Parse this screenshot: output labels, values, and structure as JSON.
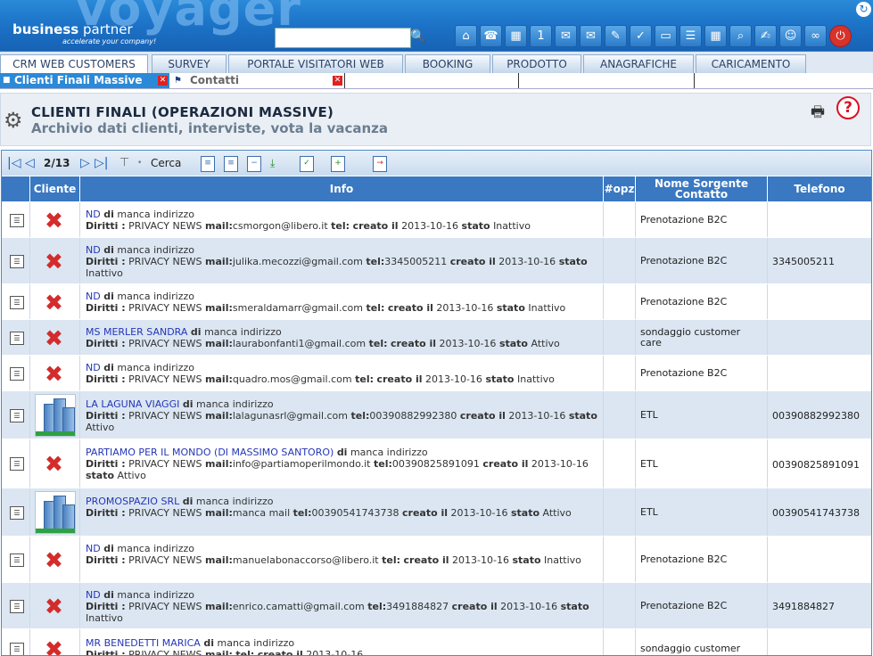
{
  "header": {
    "brand_bg": "voyager",
    "brand_name_bold": "business",
    "brand_name": " partner",
    "brand_tagline": "accelerate your company!",
    "search_placeholder": "",
    "icons": [
      "home-icon",
      "phone-icon",
      "calendar-add-icon",
      "calendar-icon",
      "mail-delete-icon",
      "mail-icon",
      "pen-icon",
      "checklist-icon",
      "card-icon",
      "document-icon",
      "calculator-icon",
      "magnifier-icon",
      "notepad-icon",
      "users-icon",
      "link-icon",
      "power-icon"
    ]
  },
  "menu": [
    "CRM WEB CUSTOMERS",
    "SURVEY",
    "PORTALE VISITATORI WEB",
    "BOOKING",
    "PRODOTTO",
    "ANAGRAFICHE",
    "CARICAMENTO"
  ],
  "tabs": [
    {
      "label": "Clienti Finali Massive",
      "active": true
    },
    {
      "label": "Contatti",
      "active": false
    }
  ],
  "page": {
    "title": "CLIENTI FINALI (OPERAZIONI MASSIVE)",
    "subtitle": "Archivio dati clienti, interviste, vota la vacanza"
  },
  "toolbar": {
    "page_indicator": "2/13",
    "search_label": "Cerca"
  },
  "columns": {
    "cliente": "Cliente",
    "info": "Info",
    "opz": "#opz",
    "sorgente": "Nome Sorgente Contatto",
    "telefono": "Telefono"
  },
  "labels": {
    "di": "di",
    "diritti": "Diritti :",
    "mail": "mail:",
    "tel": "tel:",
    "creato": "creato il",
    "stato": "stato"
  },
  "rows": [
    {
      "name": "ND",
      "address": "manca indirizzo",
      "rights": "PRIVACY NEWS",
      "mail": "csmorgon@libero.it",
      "tel": "",
      "created": "2013-10-16",
      "state": "Inattivo",
      "source": "Prenotazione B2C",
      "phone": "",
      "icon": "x"
    },
    {
      "name": "ND",
      "address": "manca indirizzo",
      "rights": "PRIVACY NEWS",
      "mail": "julika.mecozzi@gmail.com",
      "tel": "3345005211",
      "created": "2013-10-16",
      "state": "Inattivo",
      "source": "Prenotazione B2C",
      "phone": "3345005211",
      "icon": "x"
    },
    {
      "name": "ND",
      "address": "manca indirizzo",
      "rights": "PRIVACY NEWS",
      "mail": "smeraldamarr@gmail.com",
      "tel": "",
      "created": "2013-10-16",
      "state": "Inattivo",
      "source": "Prenotazione B2C",
      "phone": "",
      "icon": "x"
    },
    {
      "name": "MS MERLER SANDRA",
      "address": "manca indirizzo",
      "rights": "PRIVACY NEWS",
      "mail": "laurabonfanti1@gmail.com",
      "tel": "",
      "created": "2013-10-16",
      "state": "Attivo",
      "source": "sondaggio customer care",
      "phone": "",
      "icon": "x"
    },
    {
      "name": "ND",
      "address": "manca indirizzo",
      "rights": "PRIVACY NEWS",
      "mail": "quadro.mos@gmail.com",
      "tel": "",
      "created": "2013-10-16",
      "state": "Inattivo",
      "source": "Prenotazione B2C",
      "phone": "",
      "icon": "x"
    },
    {
      "name": "LA LAGUNA VIAGGI",
      "address": "manca indirizzo",
      "rights": "PRIVACY NEWS",
      "mail": "lalagunasrl@gmail.com",
      "tel": "00390882992380",
      "created": "2013-10-16",
      "state": "Attivo",
      "source": "ETL",
      "phone": "00390882992380",
      "icon": "building"
    },
    {
      "name": "PARTIAMO PER IL MONDO (DI MASSIMO SANTORO)",
      "address": "manca indirizzo",
      "rights": "PRIVACY NEWS",
      "mail": "info@partiamoperilmondo.it",
      "tel": "00390825891091",
      "created": "2013-10-16",
      "state": "Attivo",
      "source": "ETL",
      "phone": "00390825891091",
      "icon": "x"
    },
    {
      "name": "PROMOSPAZIO SRL",
      "address": "manca indirizzo",
      "rights": "PRIVACY NEWS",
      "mail": "manca mail",
      "tel": "00390541743738",
      "created": "2013-10-16",
      "state": "Attivo",
      "source": "ETL",
      "phone": "00390541743738",
      "icon": "building"
    },
    {
      "name": "ND",
      "address": "manca indirizzo",
      "rights": "PRIVACY NEWS",
      "mail": "manuelabonaccorso@libero.it",
      "tel": "",
      "created": "2013-10-16",
      "state": "Inattivo",
      "source": "Prenotazione B2C",
      "phone": "",
      "icon": "x"
    },
    {
      "name": "ND",
      "address": "manca indirizzo",
      "rights": "PRIVACY NEWS",
      "mail": "enrico.camatti@gmail.com",
      "tel": "3491884827",
      "created": "2013-10-16",
      "state": "Inattivo",
      "source": "Prenotazione B2C",
      "phone": "3491884827",
      "icon": "x"
    },
    {
      "name": "MR BENEDETTI MARICA",
      "address": "manca indirizzo",
      "rights": "PRIVACY NEWS",
      "mail": "",
      "tel": "",
      "created": "2013-10-16",
      "state": "",
      "source": "sondaggio customer",
      "phone": "",
      "icon": "x"
    }
  ]
}
